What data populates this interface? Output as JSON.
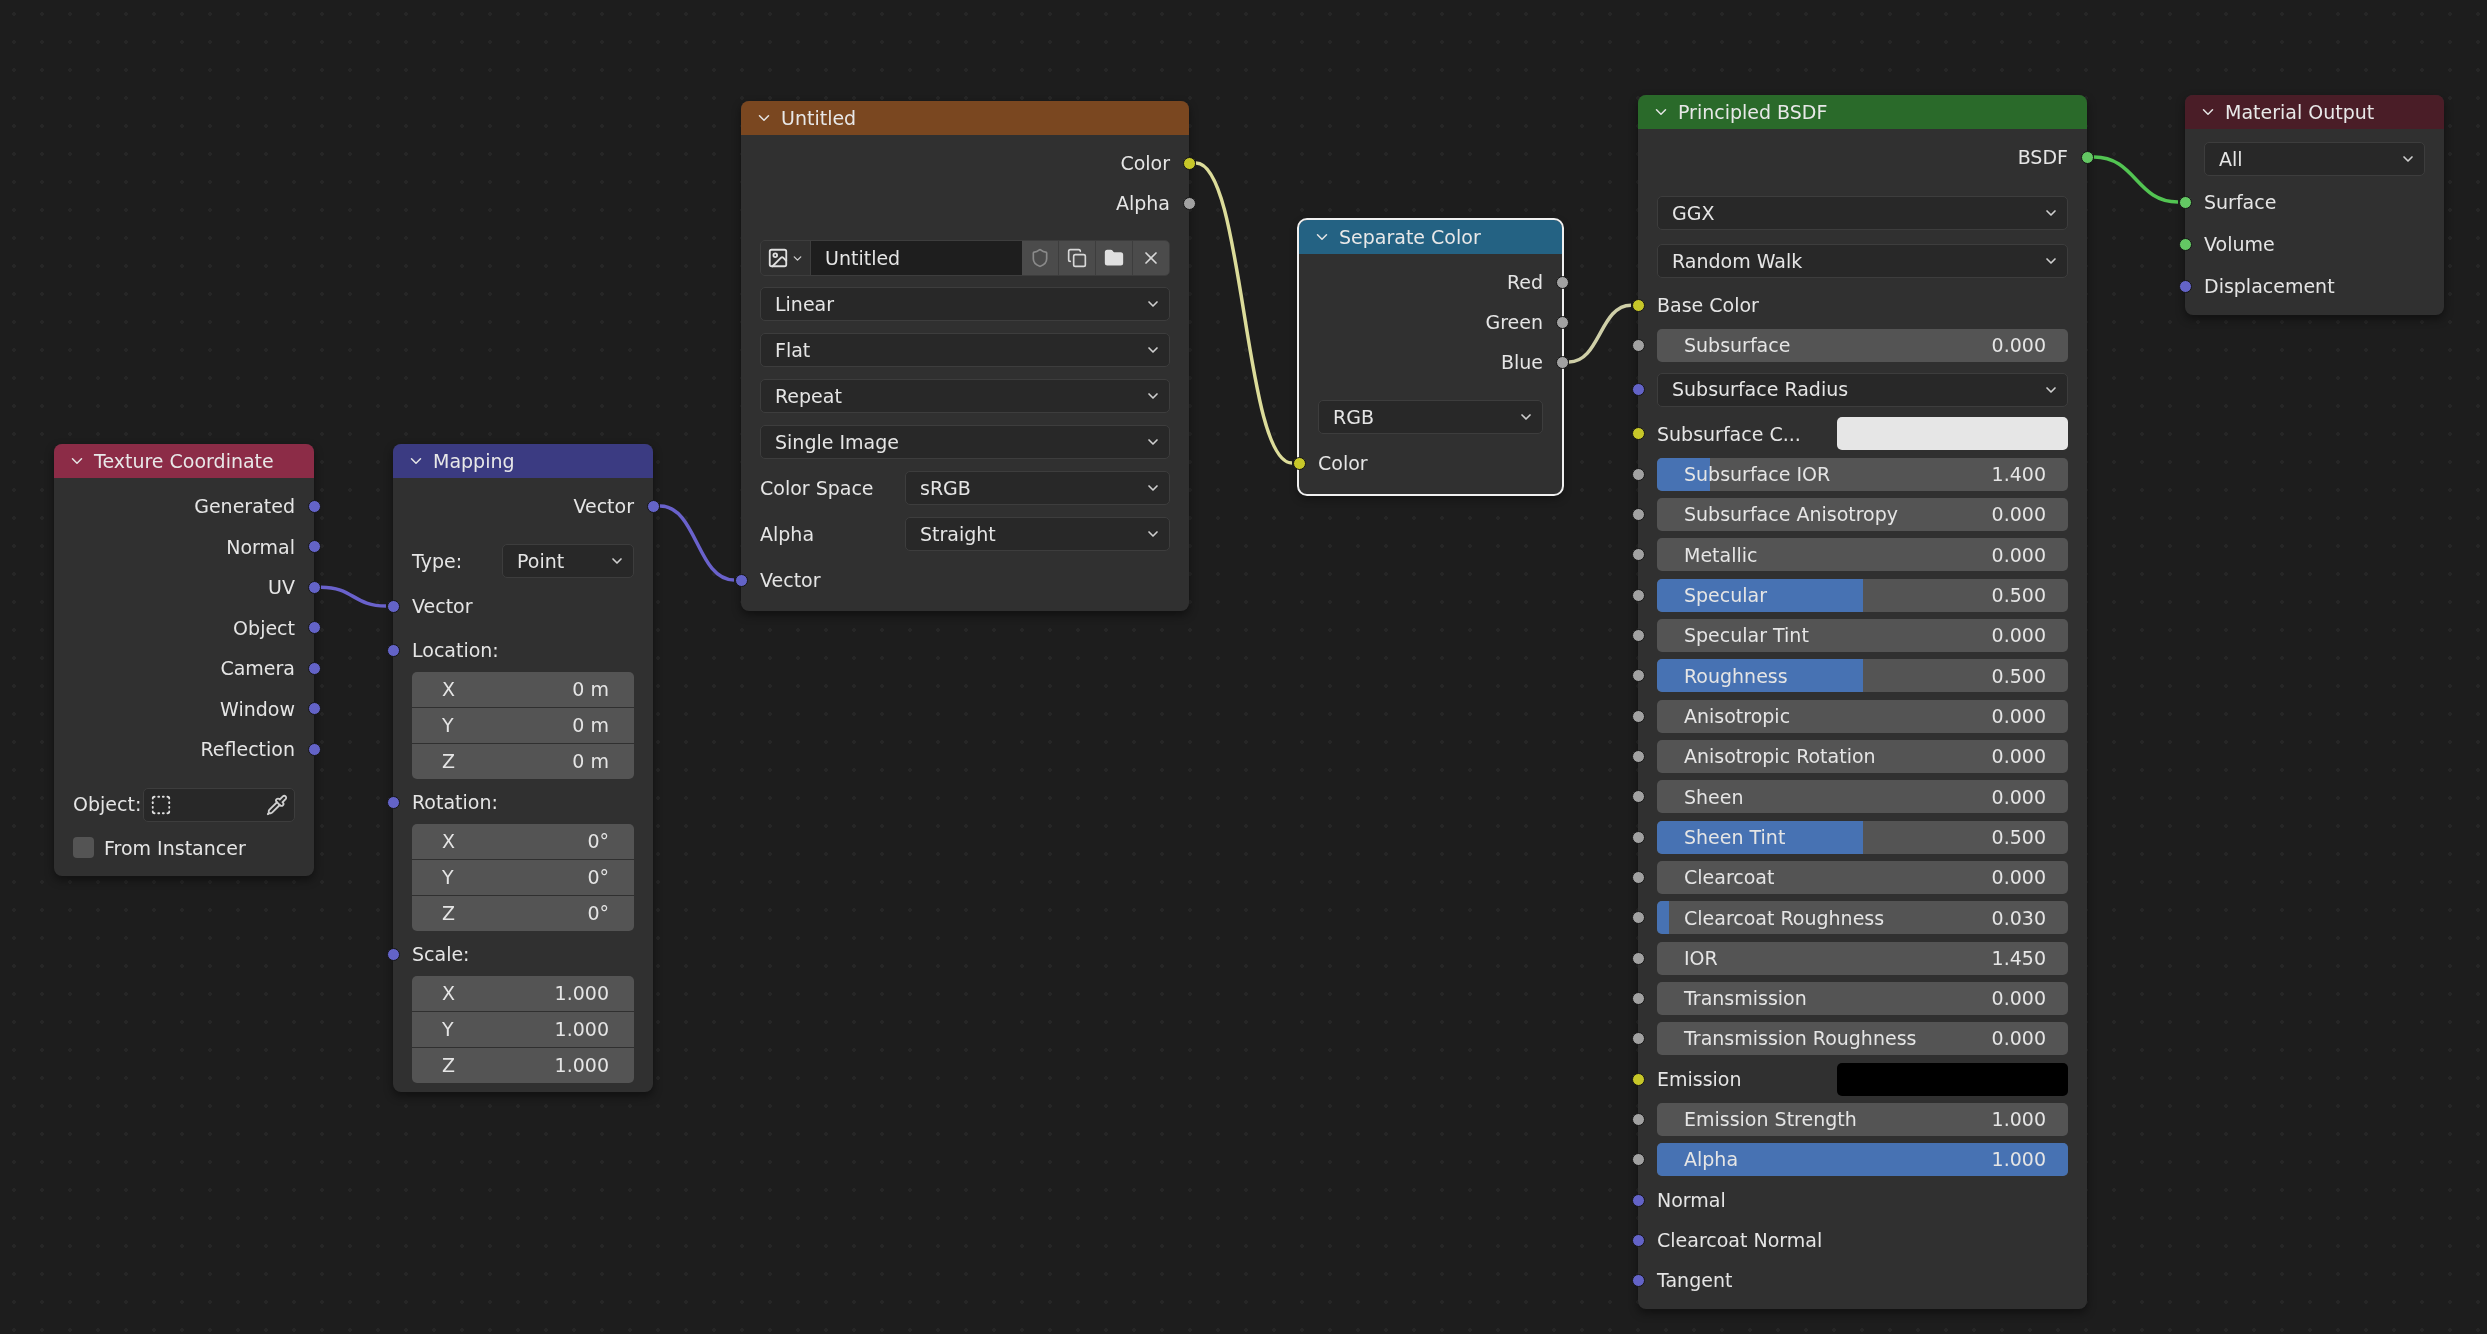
{
  "nodes": [
    {
      "title": "Texture Coordinate",
      "color": "#8c2c47",
      "selected": false,
      "rows": [
        {
          "kind": "output",
          "label": "Generated",
          "color": "#6363c7"
        },
        {
          "kind": "output",
          "label": "Normal",
          "color": "#6363c7"
        },
        {
          "kind": "output",
          "label": "UV",
          "color": "#6363c7"
        },
        {
          "kind": "output",
          "label": "Object",
          "color": "#6363c7"
        },
        {
          "kind": "output",
          "label": "Camera",
          "color": "#6363c7"
        },
        {
          "kind": "output",
          "label": "Window",
          "color": "#6363c7"
        },
        {
          "kind": "output",
          "label": "Reflection",
          "color": "#6363c7"
        },
        {
          "kind": "object_field",
          "label": "Object:"
        },
        {
          "kind": "checkbox",
          "label": "From Instancer",
          "checked": false
        }
      ]
    },
    {
      "title": "Mapping",
      "color": "#3b3b82",
      "selected": false,
      "rows": [
        {
          "kind": "output",
          "label": "Vector",
          "color": "#6363c7"
        },
        {
          "kind": "labeled_dropdown",
          "label": "Type:",
          "value": "Point"
        },
        {
          "kind": "input",
          "label": "Vector",
          "color": "#6363c7"
        },
        {
          "kind": "input",
          "label": "Location:",
          "color": "#6363c7"
        },
        {
          "kind": "vector_field",
          "axis": "X",
          "value": "0 m"
        },
        {
          "kind": "vector_field",
          "axis": "Y",
          "value": "0 m"
        },
        {
          "kind": "vector_field",
          "axis": "Z",
          "value": "0 m"
        },
        {
          "kind": "input",
          "label": "Rotation:",
          "color": "#6363c7"
        },
        {
          "kind": "vector_field",
          "axis": "X",
          "value": "0°"
        },
        {
          "kind": "vector_field",
          "axis": "Y",
          "value": "0°"
        },
        {
          "kind": "vector_field",
          "axis": "Z",
          "value": "0°"
        },
        {
          "kind": "input",
          "label": "Scale:",
          "color": "#6363c7"
        },
        {
          "kind": "vector_field",
          "axis": "X",
          "value": "1.000"
        },
        {
          "kind": "vector_field",
          "axis": "Y",
          "value": "1.000"
        },
        {
          "kind": "vector_field",
          "axis": "Z",
          "value": "1.000"
        }
      ]
    },
    {
      "title": "Untitled",
      "color": "#7a4720",
      "selected": false,
      "rows": [
        {
          "kind": "output",
          "label": "Color",
          "color": "#c7c729"
        },
        {
          "kind": "output",
          "label": "Alpha",
          "color": "#a1a1a1"
        },
        {
          "kind": "image_selector",
          "value": "Untitled"
        },
        {
          "kind": "dropdown",
          "value": "Linear"
        },
        {
          "kind": "dropdown",
          "value": "Flat"
        },
        {
          "kind": "dropdown",
          "value": "Repeat"
        },
        {
          "kind": "dropdown",
          "value": "Single Image"
        },
        {
          "kind": "labeled_dropdown",
          "label": "Color Space",
          "value": "sRGB"
        },
        {
          "kind": "labeled_dropdown",
          "label": "Alpha",
          "value": "Straight"
        },
        {
          "kind": "input",
          "label": "Vector",
          "color": "#6363c7"
        }
      ]
    },
    {
      "title": "Separate Color",
      "color": "#246283",
      "selected": true,
      "rows": [
        {
          "kind": "output",
          "label": "Red",
          "color": "#a1a1a1"
        },
        {
          "kind": "output",
          "label": "Green",
          "color": "#a1a1a1"
        },
        {
          "kind": "output",
          "label": "Blue",
          "color": "#a1a1a1"
        },
        {
          "kind": "dropdown",
          "value": "RGB"
        },
        {
          "kind": "input",
          "label": "Color",
          "color": "#c7c729"
        }
      ]
    },
    {
      "title": "Principled BSDF",
      "color": "#2a6a2a",
      "selected": false,
      "rows": [
        {
          "kind": "output",
          "label": "BSDF",
          "color": "#63c763"
        },
        {
          "kind": "dropdown",
          "value": "GGX"
        },
        {
          "kind": "dropdown",
          "value": "Random Walk"
        },
        {
          "kind": "input",
          "label": "Base Color",
          "color": "#c7c729"
        },
        {
          "kind": "number",
          "label": "Subsurface",
          "value": "0.000",
          "color": "#a1a1a1"
        },
        {
          "kind": "dropdown",
          "value": "Subsurface Radius",
          "color": "#6363c7"
        },
        {
          "kind": "color_field",
          "label": "Subsurface C...",
          "color": "#e6e6e6"
        },
        {
          "kind": "slider",
          "label": "Subsurface IOR",
          "value": "1.400",
          "level": 0.13,
          "color": "#a1a1a1"
        },
        {
          "kind": "number",
          "label": "Subsurface Anisotropy",
          "value": "0.000",
          "color": "#a1a1a1"
        },
        {
          "kind": "number",
          "label": "Metallic",
          "value": "0.000",
          "color": "#a1a1a1"
        },
        {
          "kind": "slider",
          "label": "Specular",
          "value": "0.500",
          "level": 0.5,
          "color": "#a1a1a1"
        },
        {
          "kind": "number",
          "label": "Specular Tint",
          "value": "0.000",
          "color": "#a1a1a1"
        },
        {
          "kind": "slider",
          "label": "Roughness",
          "value": "0.500",
          "level": 0.5,
          "color": "#a1a1a1"
        },
        {
          "kind": "number",
          "label": "Anisotropic",
          "value": "0.000",
          "color": "#a1a1a1"
        },
        {
          "kind": "number",
          "label": "Anisotropic Rotation",
          "value": "0.000",
          "color": "#a1a1a1"
        },
        {
          "kind": "number",
          "label": "Sheen",
          "value": "0.000",
          "color": "#a1a1a1"
        },
        {
          "kind": "slider",
          "label": "Sheen Tint",
          "value": "0.500",
          "level": 0.5,
          "color": "#a1a1a1"
        },
        {
          "kind": "number",
          "label": "Clearcoat",
          "value": "0.000",
          "color": "#a1a1a1"
        },
        {
          "kind": "slider",
          "label": "Clearcoat Roughness",
          "value": "0.030",
          "level": 0.03,
          "color": "#a1a1a1"
        },
        {
          "kind": "number",
          "label": "IOR",
          "value": "1.450",
          "color": "#a1a1a1"
        },
        {
          "kind": "number",
          "label": "Transmission",
          "value": "0.000",
          "color": "#a1a1a1"
        },
        {
          "kind": "number",
          "label": "Transmission Roughness",
          "value": "0.000",
          "color": "#a1a1a1"
        },
        {
          "kind": "color_field",
          "label": "Emission",
          "color": "#000000"
        },
        {
          "kind": "number",
          "label": "Emission Strength",
          "value": "1.000",
          "color": "#a1a1a1"
        },
        {
          "kind": "slider",
          "label": "Alpha",
          "value": "1.000",
          "level": 1,
          "color": "#a1a1a1"
        },
        {
          "kind": "input",
          "label": "Normal",
          "color": "#6363c7"
        },
        {
          "kind": "input",
          "label": "Clearcoat Normal",
          "color": "#6363c7"
        },
        {
          "kind": "input",
          "label": "Tangent",
          "color": "#6363c7"
        }
      ]
    },
    {
      "title": "Material Output",
      "color": "#4a1d27",
      "selected": false,
      "rows": [
        {
          "kind": "dropdown",
          "value": "All"
        },
        {
          "kind": "input",
          "label": "Surface",
          "color": "#63c763"
        },
        {
          "kind": "input",
          "label": "Volume",
          "color": "#63c763"
        },
        {
          "kind": "input",
          "label": "Displacement",
          "color": "#6363c7"
        }
      ]
    }
  ]
}
